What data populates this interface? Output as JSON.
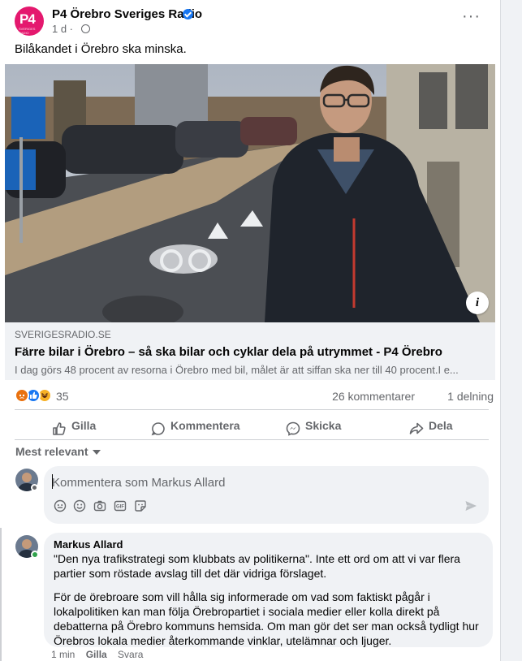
{
  "post": {
    "page_name": "P4 Örebro Sveriges Radio",
    "logo_text": "P4",
    "logo_sub": "SVERIGES RADIO",
    "time": "1 d ·",
    "text": "Bilåkandet i Örebro ska minska."
  },
  "link": {
    "domain": "SVERIGESRADIO.SE",
    "title": "Färre bilar i Örebro – så ska bilar och cyklar dela på utrymmet - P4 Örebro",
    "description": "I dag görs 48 procent av resorna i Örebro med bil, målet är att siffan ska ner till 40 procent.I e..."
  },
  "stats": {
    "reactions": "35",
    "comments": "26 kommentarer",
    "shares": "1 delning"
  },
  "actions": {
    "like": "Gilla",
    "comment": "Kommentera",
    "send": "Skicka",
    "share": "Dela"
  },
  "sort": {
    "label": "Mest relevant"
  },
  "composer": {
    "placeholder": "Kommentera som Markus Allard"
  },
  "comment": {
    "author": "Markus Allard",
    "p1": "\"Den nya trafikstrategi som klubbats av politikerna\". Inte ett ord om att vi var flera partier som röstade avslag till det där vidriga förslaget.",
    "p2": "För de örebroare som vill hålla sig informerade om vad som faktiskt pågår i lokalpolitiken kan man följa Örebropartiet i sociala medier eller kolla direkt på debatterna på Örebro kommuns hemsida. Om man gör det ser man också tydligt hur Örebros lokala medier återkommande vinklar, utelämnar och ljuger.",
    "time": "1 min",
    "like": "Gilla",
    "reply": "Svara"
  },
  "colors": {
    "brand": "#e4186e",
    "accent": "#1877f2",
    "muted": "#65676b"
  }
}
